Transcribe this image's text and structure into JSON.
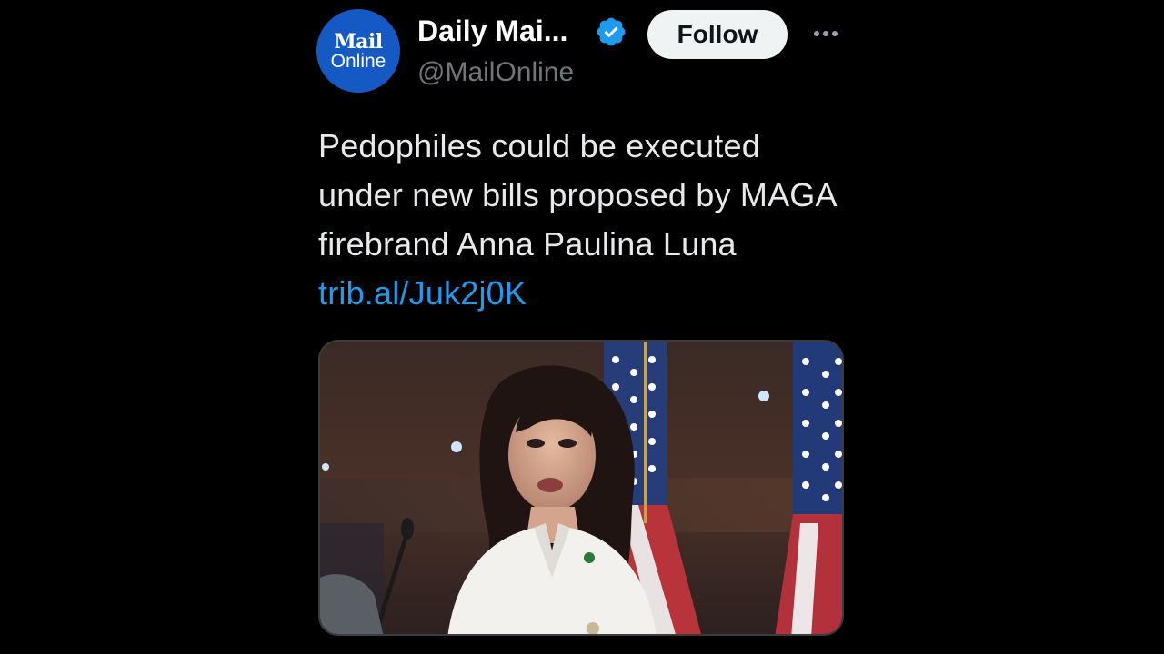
{
  "tweet": {
    "avatar": {
      "line1": "Mail",
      "line2": "Online",
      "color": "#1559c4"
    },
    "display_name": "Daily Mai...",
    "verified_icon": "verified-badge-icon",
    "handle": "@MailOnline",
    "follow_label": "Follow",
    "more_icon": "more-options-icon",
    "text": "Pedophiles could be executed under new bills proposed by MAGA firebrand Anna Paulina Luna",
    "link": "trib.al/Juk2j0K",
    "media": {
      "description": "photo"
    }
  },
  "colors": {
    "background": "#000000",
    "text": "#e7e9ea",
    "secondary": "#71767b",
    "link": "#1d9bf0",
    "verified": "#1d9bf0"
  }
}
